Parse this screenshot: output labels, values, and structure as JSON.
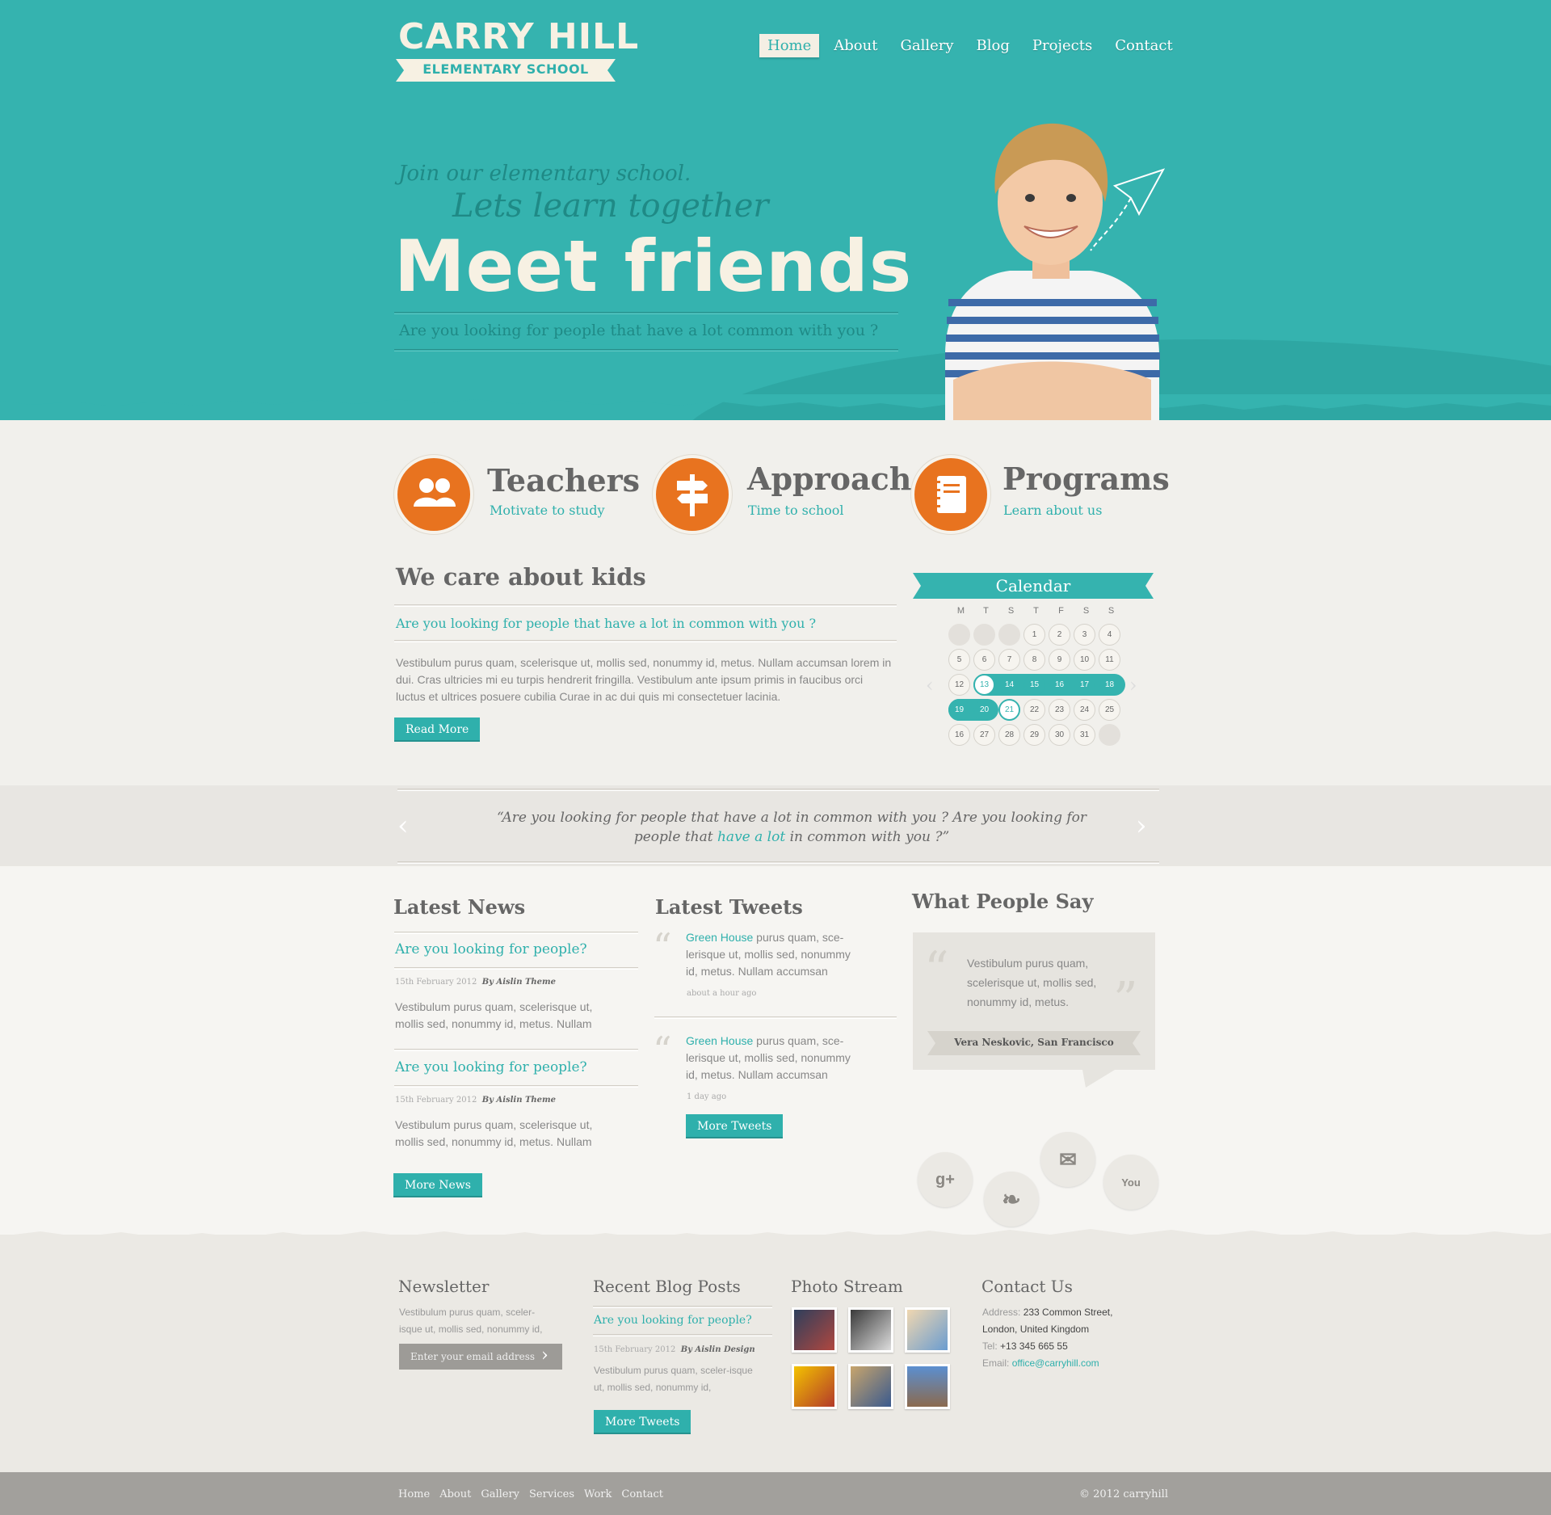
{
  "brand": {
    "title": "CARRY HILL",
    "subtitle": "ELEMENTARY SCHOOL"
  },
  "nav": [
    "Home",
    "About",
    "Gallery",
    "Blog",
    "Projects",
    "Contact"
  ],
  "hero": {
    "line1": "Join our elementary school.",
    "line2": "Lets learn together",
    "headline": "Meet friends",
    "question": "Are you looking for people that have a lot common with you ?"
  },
  "features": [
    {
      "title": "Teachers",
      "subtitle": "Motivate to study",
      "icon": "people-icon"
    },
    {
      "title": "Approach",
      "subtitle": "Time to school",
      "icon": "signpost-icon"
    },
    {
      "title": "Programs",
      "subtitle": "Learn about us",
      "icon": "notebook-icon"
    }
  ],
  "care": {
    "title": "We care about kids",
    "subtitle": "Are you looking for people that have a lot in common with you ?",
    "body": "Vestibulum purus quam, scelerisque ut, mollis sed, nonummy id, metus. Nullam accumsan lorem in dui. Cras ultricies mi eu turpis hendrerit fringilla. Vestibulum ante ipsum primis in faucibus orci luctus et ultrices posuere cubilia Curae in ac dui quis mi consectetuer lacinia.",
    "button": "Read More"
  },
  "calendar": {
    "title": "Calendar",
    "weekdays": [
      "M",
      "T",
      "S",
      "T",
      "F",
      "S",
      "S"
    ],
    "rows": [
      [
        "",
        "",
        "",
        "1",
        "2",
        "3",
        "4"
      ],
      [
        "5",
        "6",
        "7",
        "8",
        "9",
        "10",
        "11"
      ],
      [
        "12",
        "13",
        "14",
        "15",
        "16",
        "17",
        "18"
      ],
      [
        "19",
        "20",
        "21",
        "22",
        "23",
        "24",
        "25"
      ],
      [
        "16",
        "27",
        "28",
        "29",
        "30",
        "31",
        ""
      ]
    ]
  },
  "quote": {
    "before": "“Are you looking for people that have a lot in common with you ? Are you looking for people that ",
    "link": "have a lot",
    "after": " in common with you ?”"
  },
  "news": {
    "title": "Latest News",
    "items": [
      {
        "title": "Are you looking for people?",
        "date": "15th February 2012",
        "author": "By Aislin Theme",
        "text": "Vestibulum purus quam, scelerisque ut, mollis sed, nonummy id, metus. Nullam"
      },
      {
        "title": "Are you looking for people?",
        "date": "15th February 2012",
        "author": "By Aislin Theme",
        "text": "Vestibulum purus quam, scelerisque ut, mollis sed, nonummy id, metus. Nullam"
      }
    ],
    "button": "More News"
  },
  "tweets": {
    "title": "Latest Tweets",
    "items": [
      {
        "user": "Green House",
        "text": " purus quam, sce-lerisque ut, mollis sed, nonummy id, metus. Nullam accumsan",
        "time": "about a hour ago"
      },
      {
        "user": "Green House",
        "text": " purus quam, sce-lerisque ut, mollis sed, nonummy id, metus. Nullam accumsan",
        "time": "1 day ago"
      }
    ],
    "button": "More Tweets"
  },
  "testimonial": {
    "title": "What People Say",
    "text": "Vestibulum purus quam, scelerisque ut, mollis sed, nonummy id, metus.",
    "author": "Vera Neskovic, San Francisco"
  },
  "social": [
    {
      "name": "google-plus-icon",
      "glyph": "g+"
    },
    {
      "name": "twitter-icon",
      "glyph": "❧"
    },
    {
      "name": "email-icon",
      "glyph": "✉"
    },
    {
      "name": "youtube-icon",
      "glyph": "You"
    }
  ],
  "footer": {
    "newsletter": {
      "title": "Newsletter",
      "text": "Vestibulum purus quam, sceler-isque ut, mollis sed, nonummy id,",
      "placeholder": "Enter your email address"
    },
    "blog": {
      "title": "Recent Blog Posts",
      "post_title": "Are you looking for people?",
      "date": "15th February 2012",
      "author": "By Aislin Design",
      "text": "Vestibulum purus quam, sceler-isque ut, mollis sed, nonummy id,",
      "button": "More Tweets"
    },
    "photos": {
      "title": "Photo Stream"
    },
    "contact": {
      "title": "Contact Us",
      "address_label": "Address:",
      "address": "233 Common Street,",
      "city": "London, United Kingdom",
      "tel_label": "Tel:",
      "tel": "+13 345 665 55",
      "email_label": "Email:",
      "email": "office@carryhill.com"
    }
  },
  "bottom_nav": [
    "Home",
    "About",
    "Gallery",
    "Services",
    "Work",
    "Contact"
  ],
  "copyright": "© 2012 carryhill"
}
